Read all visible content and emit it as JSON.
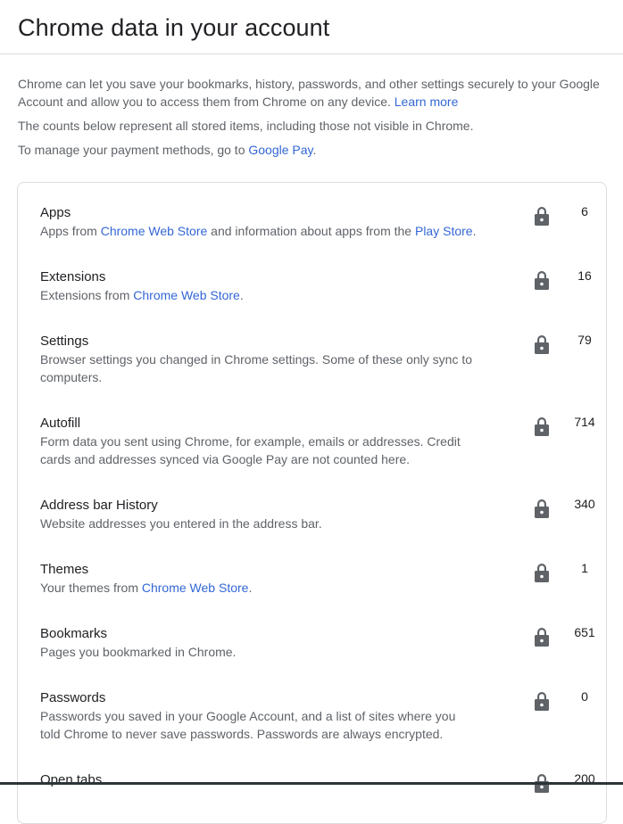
{
  "header": {
    "title": "Chrome data in your account"
  },
  "intro": {
    "paragraph1_text": "Chrome can let you save your bookmarks, history, passwords, and other settings securely to your Google Account and allow you to access them from Chrome on any device.",
    "paragraph1_link": "Learn more",
    "paragraph2_text": "The counts below represent all stored items, including those not visible in Chrome.",
    "paragraph3_text": "To manage your payment methods, go to",
    "paragraph3_link": "Google Pay",
    "paragraph3_suffix": "."
  },
  "colors": {
    "link": "#3367d6",
    "title_text": "#202124",
    "secondary_text": "#5f6368",
    "lock_icon": "#5f6368",
    "border": "#dadce0"
  },
  "items": [
    {
      "title": "Apps",
      "desc_parts": [
        "Apps from ",
        "Chrome Web Store",
        " and information about apps from the ",
        "Play Store",
        "."
      ],
      "count": "6",
      "icon": "lock-icon"
    },
    {
      "title": "Extensions",
      "desc_parts": [
        "Extensions from ",
        "Chrome Web Store",
        "."
      ],
      "count": "16",
      "icon": "lock-icon"
    },
    {
      "title": "Settings",
      "desc": "Browser settings you changed in Chrome settings. Some of these only sync to computers.",
      "count": "79",
      "icon": "lock-icon"
    },
    {
      "title": "Autofill",
      "desc": "Form data you sent using Chrome, for example, emails or addresses. Credit cards and addresses synced via Google Pay are not counted here.",
      "count": "714",
      "icon": "lock-icon"
    },
    {
      "title": "Address bar History",
      "desc": "Website addresses you entered in the address bar.",
      "count": "340",
      "icon": "lock-icon"
    },
    {
      "title": "Themes",
      "desc_parts": [
        "Your themes from ",
        "Chrome Web Store",
        "."
      ],
      "count": "1",
      "icon": "lock-icon"
    },
    {
      "title": "Bookmarks",
      "desc": "Pages you bookmarked in Chrome.",
      "count": "651",
      "icon": "lock-icon"
    },
    {
      "title": "Passwords",
      "desc": "Passwords you saved in your Google Account, and a list of sites where you told Chrome to never save passwords. Passwords are always encrypted.",
      "count": "0",
      "icon": "lock-icon"
    },
    {
      "title": "Open tabs",
      "count": "200",
      "icon": "lock-icon"
    }
  ]
}
